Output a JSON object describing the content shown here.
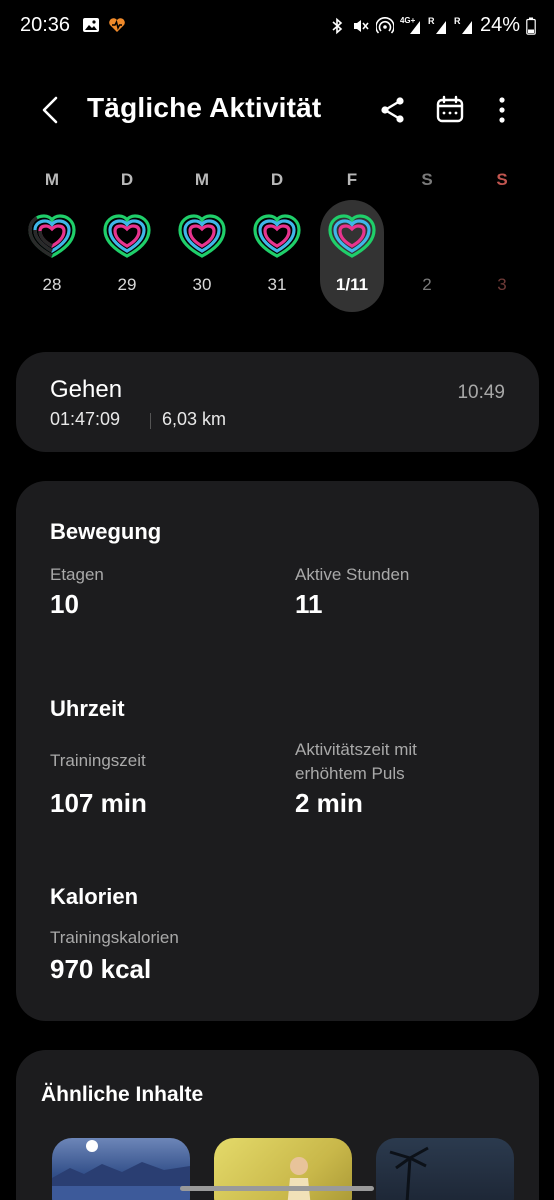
{
  "status_bar": {
    "time": "20:36",
    "signal_1": "4G+",
    "signal_2": "R",
    "signal_3": "R",
    "battery": "24%"
  },
  "header": {
    "title": "Tägliche Aktivität",
    "icons": [
      "back-icon",
      "share-icon",
      "calendar-icon",
      "more-vertical-icon"
    ]
  },
  "week": [
    {
      "letter": "M",
      "date": "28",
      "rings": true
    },
    {
      "letter": "D",
      "date": "29",
      "rings": true
    },
    {
      "letter": "M",
      "date": "30",
      "rings": true
    },
    {
      "letter": "D",
      "date": "31",
      "rings": true
    },
    {
      "letter": "F",
      "date": "1/11",
      "rings": true,
      "selected": true
    },
    {
      "letter": "S",
      "date": "2",
      "rings": false
    },
    {
      "letter": "S",
      "date": "3",
      "rings": false
    }
  ],
  "walk": {
    "title": "Gehen",
    "time": "10:49",
    "duration": "01:47:09",
    "distance": "6,03 km"
  },
  "movement": {
    "title": "Bewegung",
    "floors_label": "Etagen",
    "floors_value": "10",
    "active_hours_label": "Aktive Stunden",
    "active_hours_value": "11"
  },
  "time_section": {
    "title": "Uhrzeit",
    "training_label": "Trainingszeit",
    "training_value": "107 min",
    "elevated_label_1": "Aktivitätszeit mit",
    "elevated_label_2": "erhöhtem Puls",
    "elevated_value": "2 min"
  },
  "calories": {
    "title": "Kalorien",
    "training_label": "Trainingskalorien",
    "training_value": "970 kcal"
  },
  "similar": {
    "title": "Ähnliche Inhalte"
  },
  "colors": {
    "ring_outer": "#1fcf6a",
    "ring_middle": "#3fb6e8",
    "ring_inner": "#e8348f",
    "card_bg": "#1c1c1e"
  }
}
